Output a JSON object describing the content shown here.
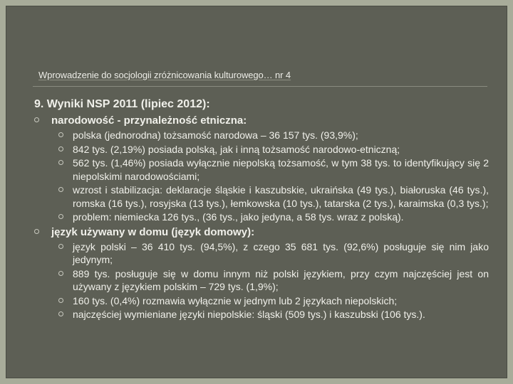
{
  "header": {
    "title": "Wprowadzenie do socjologii zróżnicowania kulturowego… nr 4"
  },
  "content": {
    "heading": "9. Wyniki NSP 2011 (lipiec 2012):",
    "sections": [
      {
        "title": "narodowość - przynależność etniczna:",
        "items": [
          "polska (jednorodna) tożsamość narodowa – 36 157 tys. (93,9%);",
          "842 tys. (2,19%) posiada polską, jak i inną tożsamość narodowo-etniczną;",
          "562 tys. (1,46%) posiada wyłącznie niepolską tożsamość, w tym 38 tys. to identyfikujący się 2 niepolskimi narodowościami;",
          "wzrost i stabilizacja: deklaracje śląskie i kaszubskie, ukraińska (49 tys.), białoruska (46 tys.), romska (16 tys.), rosyjska (13 tys.), łemkowska (10 tys.), tatarska (2 tys.), karaimska (0,3 tys.);",
          "problem: niemiecka 126 tys., (36 tys., jako jedyna, a 58 tys. wraz z polską)."
        ]
      },
      {
        "title": "język używany w domu (język domowy):",
        "items": [
          "język polski – 36 410 tys. (94,5%), z czego 35 681 tys. (92,6%) posługuje się nim jako jedynym;",
          "889 tys. posługuje się w domu innym niż polski językiem, przy czym najczęściej jest on używany z językiem polskim – 729 tys. (1,9%);",
          "160 tys. (0,4%) rozmawia wyłącznie w jednym lub 2 językach niepolskich;",
          "najczęściej wymieniane języki niepolskie: śląski (509 tys.) i kaszubski (106 tys.)."
        ]
      }
    ]
  }
}
